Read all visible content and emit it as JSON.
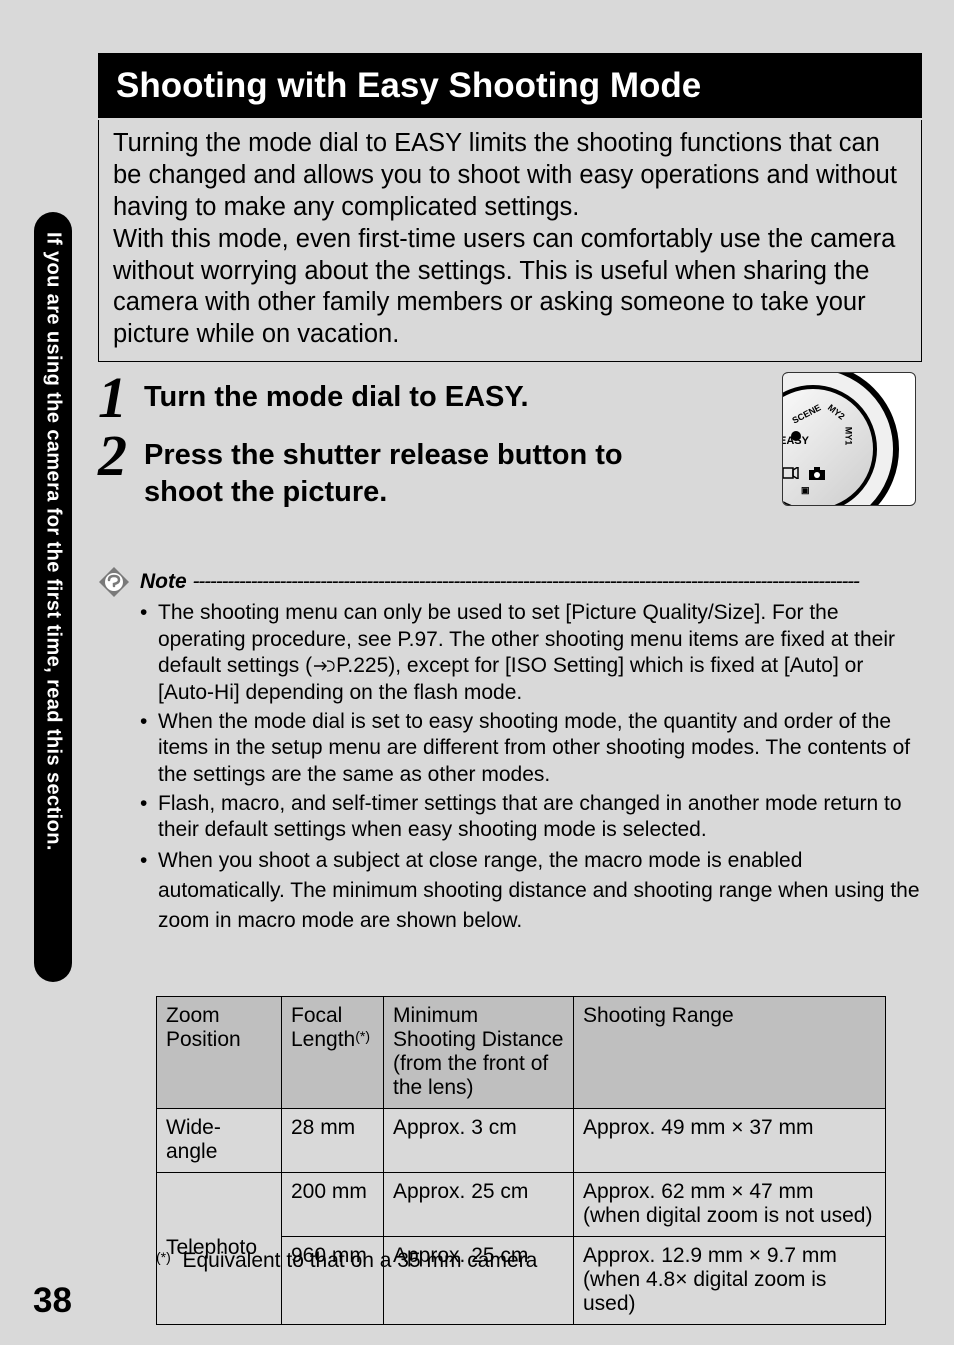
{
  "sidebar_text": "If you are using the camera for the first time, read this section.",
  "title": "Shooting with Easy Shooting Mode",
  "intro_p1": "Turning the mode dial to EASY limits the shooting functions that can be changed and allows you to shoot with easy operations and without having to make any complicated settings.",
  "intro_p2": "With this mode, even first-time users can comfortably use the camera without worrying about the settings. This is useful when sharing the camera with other family members or asking someone to take your picture while on vacation.",
  "steps": [
    {
      "num": "1",
      "text": "Turn the mode dial to EASY."
    },
    {
      "num": "2",
      "text": "Press the shutter release button to shoot the picture."
    }
  ],
  "note_label": "Note",
  "note_bullets": [
    "The shooting menu can only be used to set [Picture Quality/Size]. For the operating procedure, see P.97. The other shooting menu items are fixed at their default settings (☞P.225), except for [ISO Setting] which is fixed at [Auto] or [Auto-Hi] depending on the flash mode.",
    "When the mode dial is set to easy shooting mode, the quantity and order of the items in the setup menu are different from other shooting modes. The contents of the settings are the same as other modes.",
    "Flash, macro, and self-timer settings that are changed in another mode return to their default settings when easy shooting mode is selected.",
    "When you shoot a subject at close range, the macro mode is enabled automatically. The minimum shooting distance and shooting range when using the zoom in macro mode are shown below."
  ],
  "table": {
    "headers": [
      "Zoom Position",
      "Focal Length",
      "Minimum Shooting Distance (from the front of the lens)",
      "Shooting Range"
    ],
    "focal_sup": "(*)",
    "rows": [
      {
        "zoom": "Wide-angle",
        "focal": "28 mm",
        "dist": "Approx. 3 cm",
        "range": "Approx. 49 mm × 37 mm",
        "rowspan": 1
      },
      {
        "zoom": "Telephoto",
        "focal": "200 mm",
        "dist": "Approx. 25 cm",
        "range": "Approx. 62 mm × 47 mm\n(when digital zoom is not used)",
        "rowspan": 2
      },
      {
        "zoom": "",
        "focal": "960 mm",
        "dist": "Approx. 25 cm",
        "range": "Approx. 12.9 mm × 9.7 mm\n(when 4.8× digital zoom is used)",
        "rowspan": 0
      }
    ]
  },
  "footnote_sup": "(*)",
  "footnote_text": "Equivalent to that on a 35 mm camera",
  "page_number": "38",
  "dial": {
    "easy": "EASY",
    "scene": "SCENE",
    "my1": "MY1",
    "my2": "MY2"
  }
}
